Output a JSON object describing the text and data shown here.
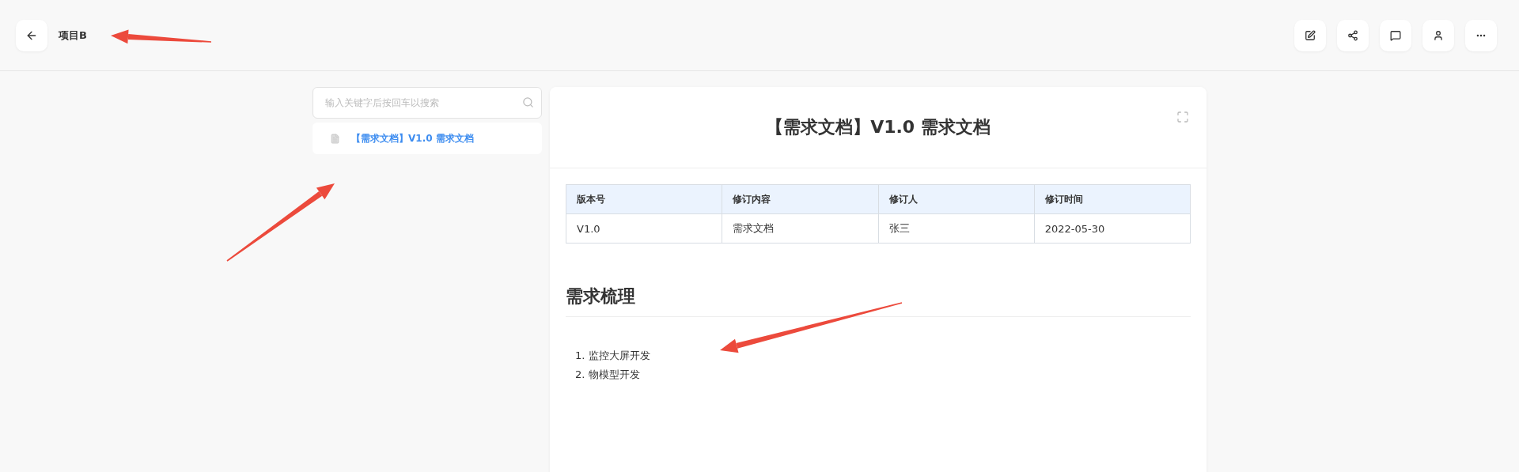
{
  "header": {
    "title": "项目B",
    "actions": [
      {
        "kind": "edit"
      },
      {
        "kind": "share"
      },
      {
        "kind": "comment"
      },
      {
        "kind": "user"
      },
      {
        "kind": "more"
      }
    ]
  },
  "sidebar": {
    "search": {
      "placeholder": "输入关键字后按回车以搜索"
    },
    "items": [
      {
        "label": "【需求文档】V1.0 需求文档",
        "selected": true
      }
    ]
  },
  "document": {
    "title": "【需求文档】V1.0 需求文档",
    "table": {
      "columns": [
        "版本号",
        "修订内容",
        "修订人",
        "修订时间"
      ],
      "rows": [
        [
          "V1.0",
          "需求文档",
          "张三",
          "2022-05-30"
        ]
      ]
    },
    "section": {
      "heading": "需求梳理",
      "items": [
        {
          "number": "1.",
          "text": "监控大屏开发"
        },
        {
          "number": "2.",
          "text": "物模型开发"
        }
      ]
    }
  }
}
